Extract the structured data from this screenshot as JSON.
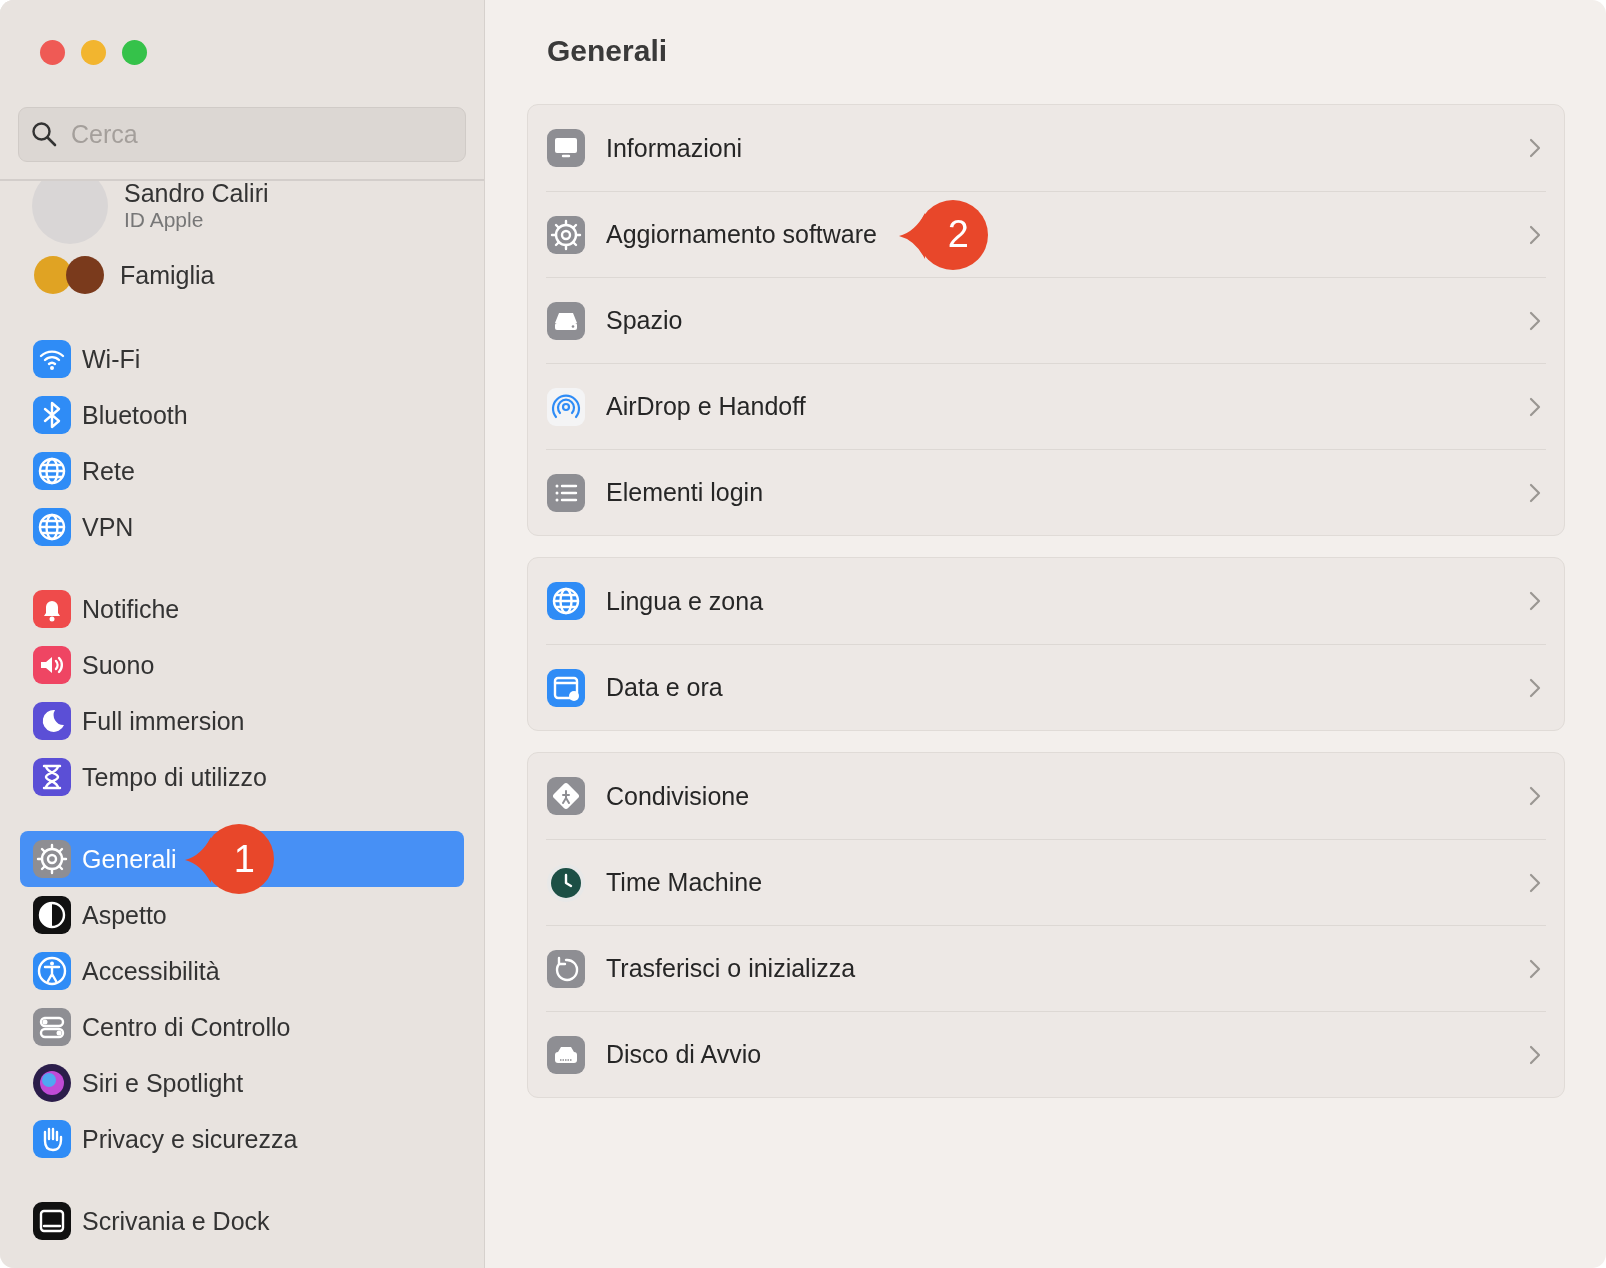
{
  "search": {
    "placeholder": "Cerca"
  },
  "account": {
    "name": "Sandro Caliri",
    "subtitle": "ID Apple"
  },
  "family": {
    "label": "Famiglia"
  },
  "sidebar": {
    "groups": [
      {
        "items": [
          {
            "label": "Wi-Fi",
            "selected": false
          },
          {
            "label": "Bluetooth",
            "selected": false
          },
          {
            "label": "Rete",
            "selected": false
          },
          {
            "label": "VPN",
            "selected": false
          }
        ]
      },
      {
        "items": [
          {
            "label": "Notifiche",
            "selected": false
          },
          {
            "label": "Suono",
            "selected": false
          },
          {
            "label": "Full immersion",
            "selected": false
          },
          {
            "label": "Tempo di utilizzo",
            "selected": false
          }
        ]
      },
      {
        "items": [
          {
            "label": "Generali",
            "selected": true,
            "callout": "1"
          },
          {
            "label": "Aspetto",
            "selected": false
          },
          {
            "label": "Accessibilità",
            "selected": false
          },
          {
            "label": "Centro di Controllo",
            "selected": false
          },
          {
            "label": "Siri e Spotlight",
            "selected": false
          },
          {
            "label": "Privacy e sicurezza",
            "selected": false
          }
        ]
      },
      {
        "items": [
          {
            "label": "Scrivania e Dock",
            "selected": false
          }
        ]
      }
    ]
  },
  "content": {
    "title": "Generali",
    "groups": [
      {
        "rows": [
          {
            "label": "Informazioni"
          },
          {
            "label": "Aggiornamento software",
            "callout": "2"
          },
          {
            "label": "Spazio"
          },
          {
            "label": "AirDrop e Handoff"
          },
          {
            "label": "Elementi login"
          }
        ]
      },
      {
        "rows": [
          {
            "label": "Lingua e zona"
          },
          {
            "label": "Data e ora"
          }
        ]
      },
      {
        "rows": [
          {
            "label": "Condivisione"
          },
          {
            "label": "Time Machine"
          },
          {
            "label": "Trasferisci o inizializza"
          },
          {
            "label": "Disco di Avvio"
          }
        ]
      }
    ]
  }
}
